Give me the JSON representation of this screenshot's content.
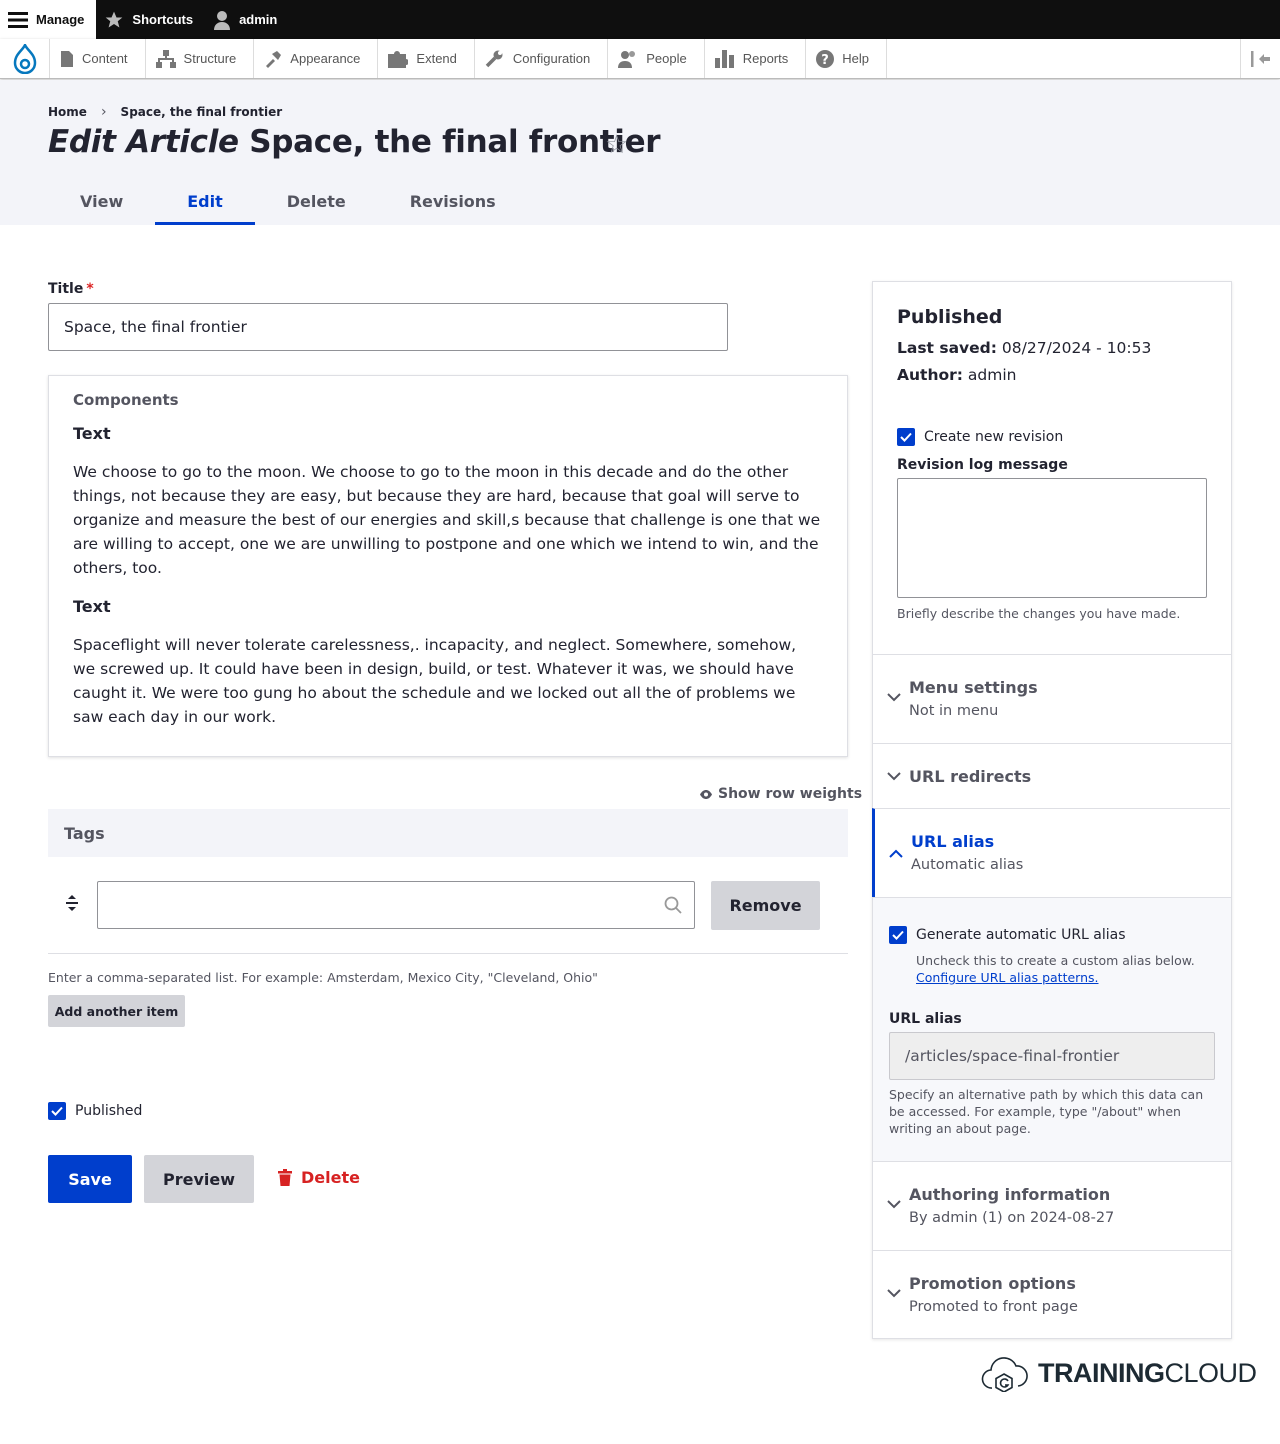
{
  "toolbar": {
    "manage": "Manage",
    "shortcuts": "Shortcuts",
    "user": "admin"
  },
  "tray": {
    "items": [
      {
        "label": "Content",
        "icon": "file-icon"
      },
      {
        "label": "Structure",
        "icon": "sitemap-icon"
      },
      {
        "label": "Appearance",
        "icon": "paintbrush-icon"
      },
      {
        "label": "Extend",
        "icon": "puzzle-icon"
      },
      {
        "label": "Configuration",
        "icon": "wrench-icon"
      },
      {
        "label": "People",
        "icon": "people-icon"
      },
      {
        "label": "Reports",
        "icon": "bar-chart-icon"
      },
      {
        "label": "Help",
        "icon": "help-icon"
      }
    ]
  },
  "breadcrumb": {
    "home": "Home",
    "current": "Space, the final frontier"
  },
  "page": {
    "title_prefix": "Edit Article",
    "title_name": "Space, the final frontier"
  },
  "tabs": [
    "View",
    "Edit",
    "Delete",
    "Revisions"
  ],
  "form": {
    "title_label": "Title",
    "title_required": "*",
    "title_value": "Space, the final frontier",
    "components_legend": "Components",
    "components": [
      {
        "label": "Text",
        "body": "We choose to go to the moon. We choose to go to the moon in this decade and do the other things, not because they are easy, but because they are hard, because that goal will serve to organize and measure the best of our energies and skill,s because that challenge is one that we are willing to accept, one we are unwilling to postpone and one which we intend to win, and the others, too."
      },
      {
        "label": "Text",
        "body": "Spaceflight will never tolerate carelessness,. incapacity, and neglect. Somewhere, somehow, we screwed up. It could have been in design, build, or test. Whatever it was, we should have caught it. We were too gung ho about the schedule and we locked out all the of problems we saw each day in our work."
      }
    ],
    "row_weights": "Show row weights",
    "tags_label": "Tags",
    "tags_value": "",
    "remove_label": "Remove",
    "tags_help": "Enter a comma-separated list. For example: Amsterdam, Mexico City, \"Cleveland, Ohio\"",
    "add_item": "Add another item",
    "published_label": "Published",
    "save": "Save",
    "preview": "Preview",
    "delete": "Delete"
  },
  "sidebar": {
    "status": "Published",
    "last_saved_label": "Last saved:",
    "last_saved_value": "08/27/2024 - 10:53",
    "author_label": "Author:",
    "author_value": "admin",
    "create_revision": "Create new revision",
    "revision_log_label": "Revision log message",
    "revision_log_value": "",
    "revision_help": "Briefly describe the changes you have made.",
    "menu_title": "Menu settings",
    "menu_summary": "Not in menu",
    "redirects_title": "URL redirects",
    "alias_title": "URL alias",
    "alias_summary": "Automatic alias",
    "generate_label": "Generate automatic URL alias",
    "generate_help": "Uncheck this to create a custom alias below.",
    "configure_link": "Configure URL alias patterns.",
    "alias_field_label": "URL alias",
    "alias_value": "/articles/space-final-frontier",
    "alias_help": "Specify an alternative path by which this data can be accessed. For example, type \"/about\" when writing an about page.",
    "authoring_title": "Authoring information",
    "authoring_summary": "By admin (1) on 2024-08-27",
    "promotion_title": "Promotion options",
    "promotion_summary": "Promoted to front page"
  },
  "brand": {
    "bold": "TRAINING",
    "light": "CLOUD"
  },
  "colors": {
    "accent": "#003ecc",
    "danger": "#d72222",
    "toolbar_bg": "#0f0f0f",
    "header_bg": "#f3f4f9"
  }
}
